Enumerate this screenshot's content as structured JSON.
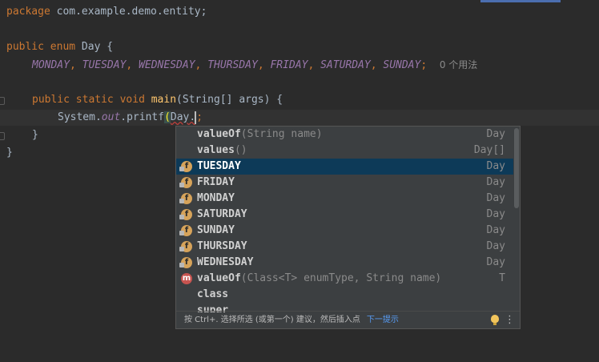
{
  "code": {
    "line1": {
      "kw": "package",
      "rest": " com.example.demo.entity;"
    },
    "line3": {
      "kw1": "public",
      "kw2": "enum",
      "rest": " Day {"
    },
    "line4": {
      "constants": [
        "MONDAY",
        "TUESDAY",
        "WEDNESDAY",
        "THURSDAY",
        "FRIDAY",
        "SATURDAY",
        "SUNDAY"
      ],
      "usage_hint": "0 个用法"
    },
    "line6": {
      "kw1": "public",
      "kw2": "static",
      "kw3": "void",
      "fn": "main",
      "params": "(String[] args) {"
    },
    "line7": {
      "prefix": "System.",
      "field": "out",
      "call": ".printf",
      "open": "(",
      "arg": "Day.",
      "end": ";"
    },
    "line8": "}",
    "line9": "}"
  },
  "completion": {
    "items": [
      {
        "icon": "",
        "name": "valueOf",
        "sig": "(String name)",
        "type": "Day"
      },
      {
        "icon": "",
        "name": "values",
        "sig": "()",
        "type": "Day[]"
      },
      {
        "icon": "field",
        "name": "TUESDAY",
        "sig": "",
        "type": "Day",
        "selected": true
      },
      {
        "icon": "field",
        "name": "FRIDAY",
        "sig": "",
        "type": "Day"
      },
      {
        "icon": "field",
        "name": "MONDAY",
        "sig": "",
        "type": "Day"
      },
      {
        "icon": "field",
        "name": "SATURDAY",
        "sig": "",
        "type": "Day"
      },
      {
        "icon": "field",
        "name": "SUNDAY",
        "sig": "",
        "type": "Day"
      },
      {
        "icon": "field",
        "name": "THURSDAY",
        "sig": "",
        "type": "Day"
      },
      {
        "icon": "field",
        "name": "WEDNESDAY",
        "sig": "",
        "type": "Day"
      },
      {
        "icon": "method",
        "name": "valueOf",
        "sig": "(Class<T> enumType, String name)",
        "type": "T"
      },
      {
        "icon": "",
        "name": "class",
        "sig": "",
        "type": ""
      },
      {
        "icon": "",
        "name": "super",
        "sig": "",
        "type": ""
      }
    ],
    "field_icon_letter": "f",
    "method_icon_letter": "m",
    "footer_text": "按 Ctrl+. 选择所选 (或第一个) 建议，然后插入点",
    "footer_link": "下一提示",
    "footer_menu": "⋮"
  },
  "colors": {
    "background": "#2b2b2b",
    "keyword": "#cc7832",
    "function": "#ffc66d",
    "enum_constant": "#9876aa",
    "selection": "#0d3a58"
  }
}
